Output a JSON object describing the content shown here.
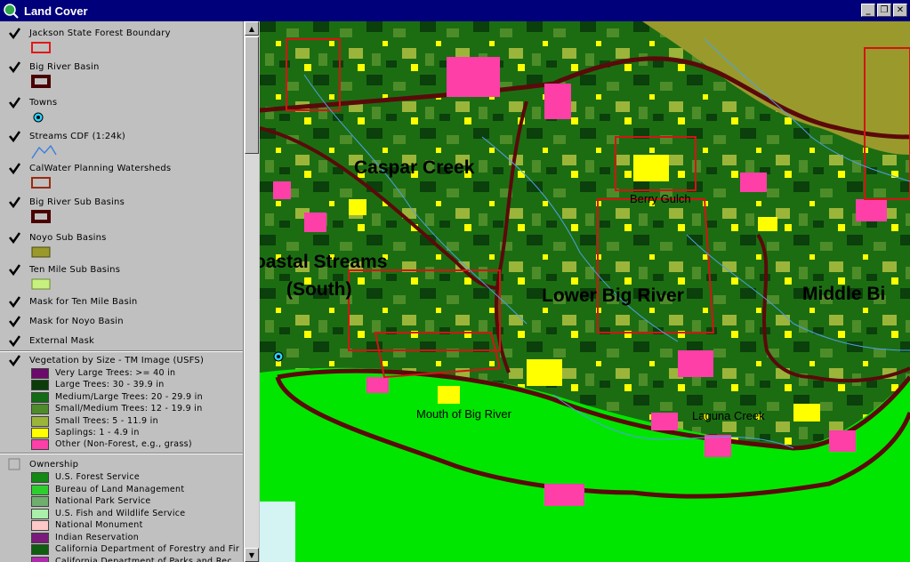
{
  "window": {
    "title": "Land Cover",
    "buttons": [
      "minimize",
      "restore",
      "close"
    ]
  },
  "toc": {
    "layers": [
      {
        "name": "Jackson State Forest Boundary",
        "checked": true,
        "symbol": "red-outline-box"
      },
      {
        "name": "Big River Basin",
        "checked": true,
        "symbol": "dark-red-thick-box"
      },
      {
        "name": "Towns",
        "checked": true,
        "symbol": "cyan-circle"
      },
      {
        "name": "Streams CDF (1:24k)",
        "checked": true,
        "symbol": "blue-line"
      },
      {
        "name": "CalWater Planning Watersheds",
        "checked": true,
        "symbol": "brown-outline-box"
      },
      {
        "name": "Big River Sub Basins",
        "checked": true,
        "symbol": "dark-red-thick-box"
      },
      {
        "name": "Noyo Sub Basins",
        "checked": true,
        "symbol": "olive-fill"
      },
      {
        "name": "Ten Mile Sub Basins",
        "checked": true,
        "symbol": "lime-fill"
      },
      {
        "name": "Mask for Ten Mile Basin",
        "checked": true
      },
      {
        "name": "Mask for Noyo Basin",
        "checked": true
      },
      {
        "name": "External Mask",
        "checked": true
      }
    ],
    "vegetation": {
      "name": "Vegetation by Size - TM Image (USFS)",
      "checked": true,
      "classes": [
        {
          "label": "Very Large Trees: >= 40  in",
          "color": "#6b0a6b"
        },
        {
          "label": "Large Trees: 30 - 39.9 in",
          "color": "#0a3d0a"
        },
        {
          "label": "Medium/Large Trees: 20 - 29.9 in",
          "color": "#136b13"
        },
        {
          "label": "Small/Medium Trees: 12 - 19.9 in",
          "color": "#4e8c2a"
        },
        {
          "label": "Small Trees: 5 - 11.9 in",
          "color": "#9bb53a"
        },
        {
          "label": "Saplings: 1 - 4.9 in",
          "color": "#ffff00"
        },
        {
          "label": "Other (Non-Forest, e.g., grass)",
          "color": "#ff3fa8"
        }
      ]
    },
    "ownership": {
      "name": "Ownership",
      "checked": false,
      "classes": [
        {
          "label": "U.S. Forest Service",
          "color": "#138a13"
        },
        {
          "label": "Bureau of Land Management",
          "color": "#2dcf2d"
        },
        {
          "label": "National Park Service",
          "color": "#6fae6f"
        },
        {
          "label": "U.S. Fish and Wildlife Service",
          "color": "#aaf0aa"
        },
        {
          "label": "National Monument",
          "color": "#ffc8c8"
        },
        {
          "label": "Indian Reservation",
          "color": "#7a1a7a"
        },
        {
          "label": "California Department of Forestry and Fir",
          "color": "#0f5e0f"
        },
        {
          "label": "California Department of Parks and Rec",
          "color": "#b02ab0"
        }
      ]
    }
  },
  "map": {
    "labels": {
      "caspar": "Caspar Creek",
      "coastal": "oastal Streams",
      "south": "(South)",
      "lower_big": "Lower Big River",
      "middle": "Middle Bi",
      "berry": "Berry Gulch",
      "mouth": "Mouth of Big River",
      "laguna": "Laguna Creek"
    }
  }
}
